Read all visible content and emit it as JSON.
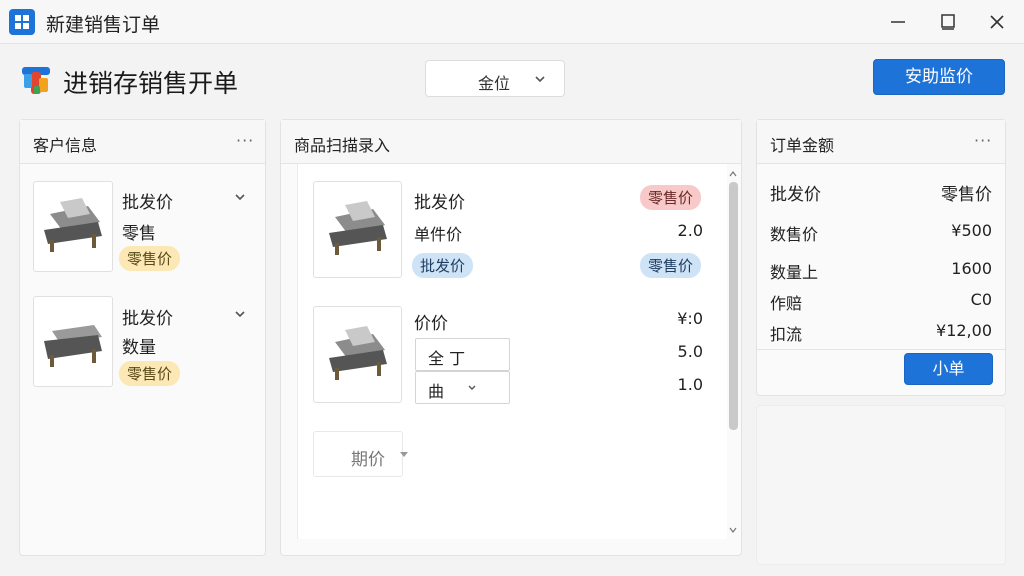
{
  "window": {
    "title": "新建销售订单",
    "controls": {
      "minimize": "minimize-icon",
      "maximize": "maximize-icon",
      "close": "close-icon"
    }
  },
  "header": {
    "title": "进销存销售开单",
    "warehouse_select": {
      "value": "金位"
    },
    "primary_button": "安助监价"
  },
  "customer_panel": {
    "title": "客户信息",
    "items": [
      {
        "title": "批发价",
        "line2": "零售",
        "badge": "零售价"
      },
      {
        "title": "批发价",
        "line2": "数量",
        "badge": "零售价"
      }
    ]
  },
  "scan_panel": {
    "title": "商品扫描录入",
    "item1": {
      "title": "批发价",
      "badge_right": "零售价",
      "line2_label": "单件价",
      "line2_value": "2.0",
      "badge_left": "批发价",
      "badge_right2": "零售价"
    },
    "item2": {
      "title": "价价",
      "price": "¥:0",
      "field1": "全 丁",
      "field1_value": "5.0",
      "field2": "曲",
      "field2_value": "1.0"
    },
    "dropdown": {
      "value": "期价"
    }
  },
  "order_panel": {
    "title": "订单金额",
    "head_left": "批发价",
    "head_right": "零售价",
    "rows": [
      {
        "label": "数售价",
        "value": "¥500"
      },
      {
        "label": "数量上",
        "value": "1600"
      },
      {
        "label": "作赔",
        "value": "C0"
      },
      {
        "label": "扣流",
        "value": "¥12,00"
      }
    ],
    "button": "小单"
  },
  "colors": {
    "accent": "#1e73d8",
    "badge_yellow": "#fbe8b4",
    "badge_red": "#f7c9c8",
    "badge_blue": "#cfe3f7"
  }
}
